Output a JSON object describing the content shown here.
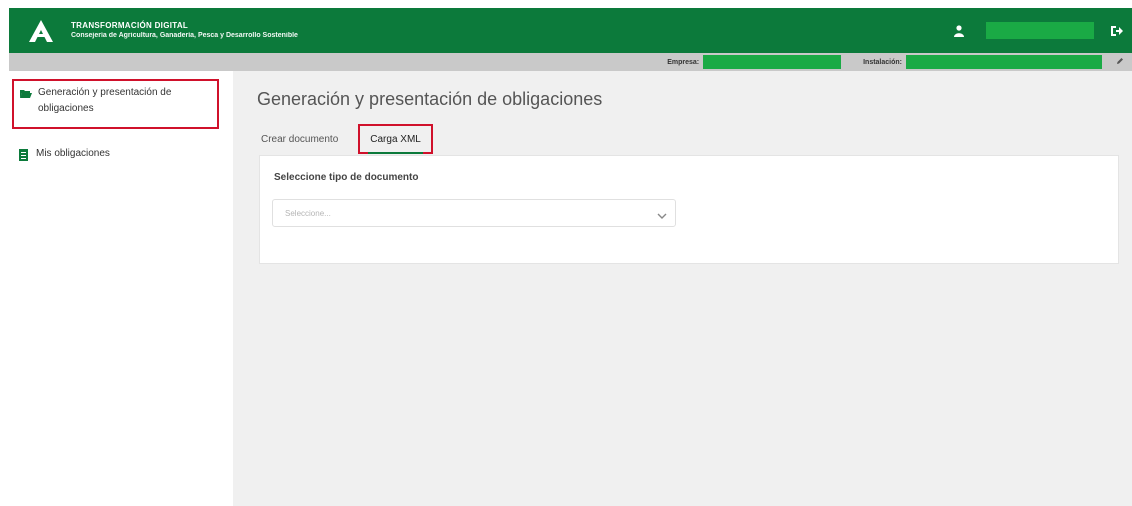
{
  "header": {
    "title": "TRANSFORMACIÓN DIGITAL",
    "subtitle": "Consejería de Agricultura, Ganadería, Pesca y Desarrollo Sostenible",
    "brand_color": "#0c7a3b",
    "icons": {
      "logo": "andalucia-logo-icon",
      "user": "user-icon",
      "logout": "logout-icon"
    }
  },
  "subbar": {
    "empresa_label": "Empresa:",
    "instalacion_label": "Instalación:"
  },
  "sidebar": {
    "items": [
      {
        "label": "Generación y presentación de obligaciones",
        "icon": "folder-open-icon",
        "active": true
      },
      {
        "label": "Mis obligaciones",
        "icon": "document-icon",
        "active": false
      }
    ]
  },
  "main": {
    "title": "Generación y presentación de obligaciones",
    "tabs": [
      {
        "label": "Crear documento",
        "active": false
      },
      {
        "label": "Carga XML",
        "active": true
      }
    ],
    "form": {
      "field_label": "Seleccione tipo de documento",
      "select_placeholder": "Seleccione..."
    }
  },
  "colors": {
    "highlight": "#d0112b",
    "accent_green": "#1aaa45"
  }
}
